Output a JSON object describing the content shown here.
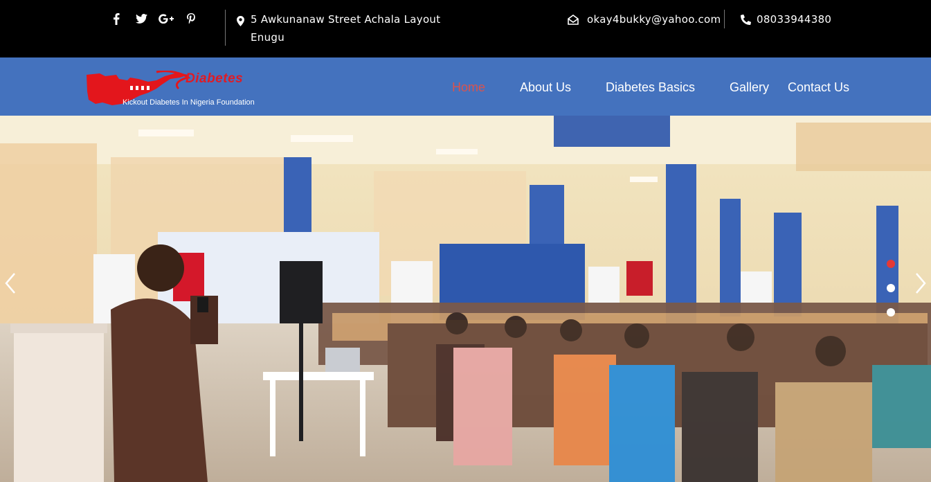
{
  "topbar": {
    "social": [
      "facebook-icon",
      "twitter-icon",
      "google-plus-icon",
      "pinterest-icon"
    ],
    "address": "5 Awkunanaw Street Achala Layout Enugu",
    "email": "okay4bukky@yahoo.com",
    "phone": "08033944380"
  },
  "logo": {
    "brand": "Diabetes",
    "tagline": "Kickout Diabetes In Nigeria Foundation"
  },
  "nav": {
    "items": [
      {
        "label": "Home",
        "active": true
      },
      {
        "label": "About Us",
        "active": false
      },
      {
        "label": "Diabetes Basics",
        "active": false
      },
      {
        "label": "Gallery",
        "active": false
      },
      {
        "label": "Contact Us",
        "active": false
      }
    ]
  },
  "slider": {
    "slide_count": 3,
    "active_slide": 1
  },
  "colors": {
    "topbar_bg": "#000000",
    "nav_bg": "#4472be",
    "active_link": "#d9534f",
    "dot_active": "#e53935"
  }
}
